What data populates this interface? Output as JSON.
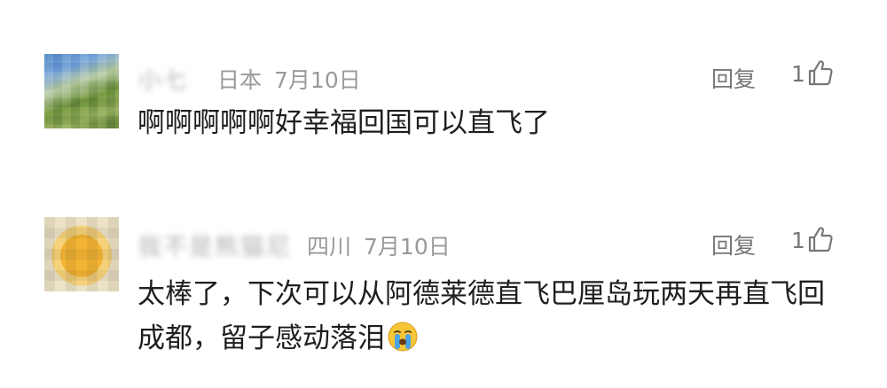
{
  "comments": [
    {
      "username": "小七",
      "location": "日本",
      "date": "7月10日",
      "reply_label": "回复",
      "likes": "1",
      "text": "啊啊啊啊啊好幸福回国可以直飞了",
      "avatar_icon": "avatar-landscape-photo"
    },
    {
      "username": "我不是熊猫尼",
      "location": "四川",
      "date": "7月10日",
      "reply_label": "回复",
      "likes": "1",
      "text": "太棒了，下次可以从阿德莱德直飞巴厘岛玩两天再直飞回成都，留子感动落泪",
      "emoji_icon": "crying-face-emoji",
      "avatar_icon": "avatar-yellow-circle"
    }
  ],
  "colors": {
    "text": "#1e1e1e",
    "meta": "#9a9a9a",
    "action": "#777777"
  }
}
